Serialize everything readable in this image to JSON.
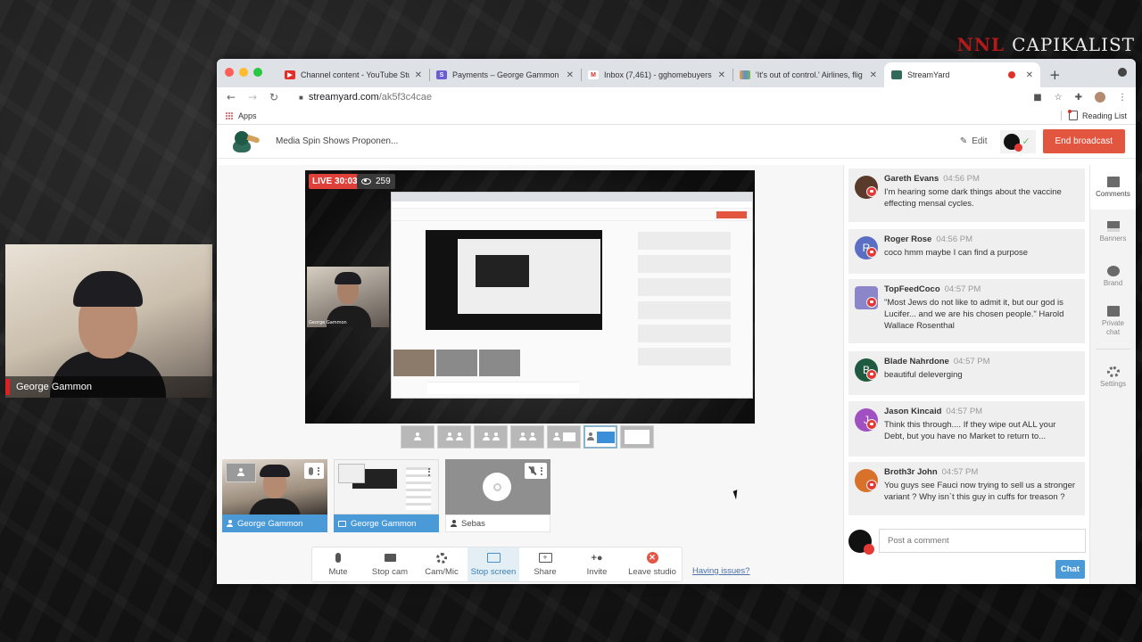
{
  "overlay": {
    "brand_prefix": "NNL",
    "brand_name": "CAPIKALIST",
    "cam_name": "George Gammon"
  },
  "browser": {
    "tabs": [
      {
        "title": "Channel content - YouTube Stu",
        "favicon": "youtube-icon",
        "color": "#e52d27"
      },
      {
        "title": "Payments – George Gammon -",
        "favicon": "s-icon",
        "color": "#6b5bd6"
      },
      {
        "title": "Inbox (7,461) - gghomebuyers",
        "favicon": "gmail-icon",
        "color": "#d93025"
      },
      {
        "title": "'It's out of control.' Airlines, flig",
        "favicon": "nbc-icon",
        "color": "#f0a030"
      },
      {
        "title": "StreamYard",
        "favicon": "streamyard-icon",
        "color": "#2f6b58",
        "active": true,
        "recording": true
      }
    ],
    "url_domain": "streamyard.com",
    "url_path": "/ak5f3c4cae",
    "bookmarks": {
      "apps": "Apps",
      "reading_list": "Reading List"
    }
  },
  "header": {
    "broadcast_title": "Media Spin Shows Proponen...",
    "edit_label": "Edit",
    "end_label": "End broadcast"
  },
  "stage": {
    "live_label": "LIVE 30:03",
    "viewers": "259"
  },
  "layouts": {
    "count": 7,
    "active_index": 5
  },
  "tiles": [
    {
      "name": "George Gammon",
      "type": "camera",
      "on_stage": true
    },
    {
      "name": "George Gammon",
      "type": "screen",
      "on_stage": true
    },
    {
      "name": "Sebas",
      "type": "camera",
      "on_stage": false,
      "muted": true
    }
  ],
  "toolbar": {
    "buttons": [
      {
        "label": "Mute",
        "icon": "mic-icon"
      },
      {
        "label": "Stop cam",
        "icon": "camera-icon"
      },
      {
        "label": "Cam/Mic",
        "icon": "gear-icon"
      },
      {
        "label": "Stop screen",
        "icon": "screen-icon",
        "active": true
      },
      {
        "label": "Share",
        "icon": "share-screen-icon"
      },
      {
        "label": "Invite",
        "icon": "invite-icon"
      },
      {
        "label": "Leave studio",
        "icon": "leave-icon"
      }
    ],
    "issues_link": "Having issues?"
  },
  "chat": {
    "messages": [
      {
        "author": "Gareth Evans",
        "time": "04:56 PM",
        "text": "I'm hearing some dark things about the vaccine effecting mensal cycles.",
        "avatar_color": "#5a3a2a",
        "initial": ""
      },
      {
        "author": "Roger Rose",
        "time": "04:56 PM",
        "text": "coco hmm maybe I can find a purpose",
        "avatar_color": "#5a6fc4",
        "initial": "R"
      },
      {
        "author": "TopFeedCoco",
        "time": "04:57 PM",
        "text": "\"Most Jews do not like to admit it, but our god is Lucifer... and we are his chosen people.\" Harold Wallace Rosenthal",
        "avatar_color": "#8a86c9",
        "initial": ""
      },
      {
        "author": "Blade Nahrdone",
        "time": "04:57 PM",
        "text": "beautiful deleverging",
        "avatar_color": "#1f5a40",
        "initial": "B"
      },
      {
        "author": "Jason Kincaid",
        "time": "04:57 PM",
        "text": "Think this through.... If they wipe out ALL your Debt, but you have no Market to return to...",
        "avatar_color": "#a050c0",
        "initial": "J"
      },
      {
        "author": "Broth3r John",
        "time": "04:57 PM",
        "text": "You guys see Fauci now trying to sell us a stronger variant ? Why isn`t this guy in cuffs for treason ?",
        "avatar_color": "#d8712a",
        "initial": ""
      }
    ],
    "post_placeholder": "Post a comment",
    "chat_button": "Chat"
  },
  "sidebar": {
    "items": [
      {
        "label": "Comments",
        "active": true
      },
      {
        "label": "Banners"
      },
      {
        "label": "Brand"
      },
      {
        "label": "Private chat"
      },
      {
        "label": "Settings"
      }
    ]
  }
}
